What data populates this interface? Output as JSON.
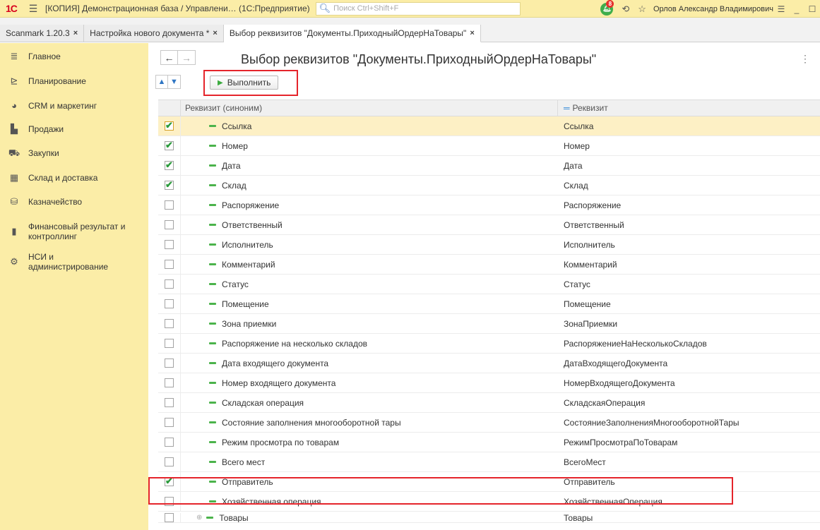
{
  "titlebar": {
    "logo": "1С",
    "title": "[КОПИЯ] Демонстрационная база / Управлени… (1С:Предприятие)",
    "search_placeholder": "Поиск Ctrl+Shift+F",
    "notifications_count": "8",
    "user": "Орлов Александр Владимирович"
  },
  "tabs": [
    {
      "label": "Scanmark 1.20.3"
    },
    {
      "label": "Настройка нового документа *"
    },
    {
      "label": "Выбор реквизитов \"Документы.ПриходныйОрдерНаТовары\""
    }
  ],
  "sidebar": {
    "items": [
      {
        "label": "Главное",
        "icon": "menu-lines-icon"
      },
      {
        "label": "Планирование",
        "icon": "chart-plan-icon"
      },
      {
        "label": "CRM и маркетинг",
        "icon": "pie-icon"
      },
      {
        "label": "Продажи",
        "icon": "bag-icon"
      },
      {
        "label": "Закупки",
        "icon": "cart-icon"
      },
      {
        "label": "Склад и доставка",
        "icon": "warehouse-icon"
      },
      {
        "label": "Казначейство",
        "icon": "coins-icon"
      },
      {
        "label": "Финансовый результат и контроллинг",
        "icon": "bars-icon"
      },
      {
        "label": "НСИ и администрирование",
        "icon": "gear-icon"
      }
    ]
  },
  "form": {
    "title": "Выбор реквизитов \"Документы.ПриходныйОрдерНаТовары\"",
    "run_label": "Выполнить"
  },
  "table": {
    "headers": {
      "synonym": "Реквизит (синоним)",
      "requisite": "Реквизит"
    },
    "rows": [
      {
        "checked": true,
        "synonym": "Ссылка",
        "requisite": "Ссылка",
        "selected": true
      },
      {
        "checked": true,
        "synonym": "Номер",
        "requisite": "Номер"
      },
      {
        "checked": true,
        "synonym": "Дата",
        "requisite": "Дата"
      },
      {
        "checked": true,
        "synonym": "Склад",
        "requisite": "Склад"
      },
      {
        "checked": false,
        "synonym": "Распоряжение",
        "requisite": "Распоряжение"
      },
      {
        "checked": false,
        "synonym": "Ответственный",
        "requisite": "Ответственный"
      },
      {
        "checked": false,
        "synonym": "Исполнитель",
        "requisite": "Исполнитель"
      },
      {
        "checked": false,
        "synonym": "Комментарий",
        "requisite": "Комментарий"
      },
      {
        "checked": false,
        "synonym": "Статус",
        "requisite": "Статус"
      },
      {
        "checked": false,
        "synonym": "Помещение",
        "requisite": "Помещение"
      },
      {
        "checked": false,
        "synonym": "Зона приемки",
        "requisite": "ЗонаПриемки"
      },
      {
        "checked": false,
        "synonym": "Распоряжение на несколько складов",
        "requisite": "РаспоряжениеНаНесколькоСкладов"
      },
      {
        "checked": false,
        "synonym": "Дата входящего документа",
        "requisite": "ДатаВходящегоДокумента"
      },
      {
        "checked": false,
        "synonym": "Номер входящего документа",
        "requisite": "НомерВходящегоДокумента"
      },
      {
        "checked": false,
        "synonym": "Складская операция",
        "requisite": "СкладскаяОперация"
      },
      {
        "checked": false,
        "synonym": "Состояние заполнения многооборотной тары",
        "requisite": "СостояниеЗаполненияМногооборотнойТары"
      },
      {
        "checked": false,
        "synonym": "Режим просмотра по товарам",
        "requisite": "РежимПросмотраПоТоварам"
      },
      {
        "checked": false,
        "synonym": "Всего мест",
        "requisite": "ВсегоМест"
      },
      {
        "checked": true,
        "synonym": "Отправитель",
        "requisite": "Отправитель"
      },
      {
        "checked": false,
        "synonym": "Хозяйственная операция",
        "requisite": "ХозяйственнаяОперация"
      },
      {
        "checked": false,
        "synonym": "Товары",
        "requisite": "Товары"
      }
    ]
  }
}
